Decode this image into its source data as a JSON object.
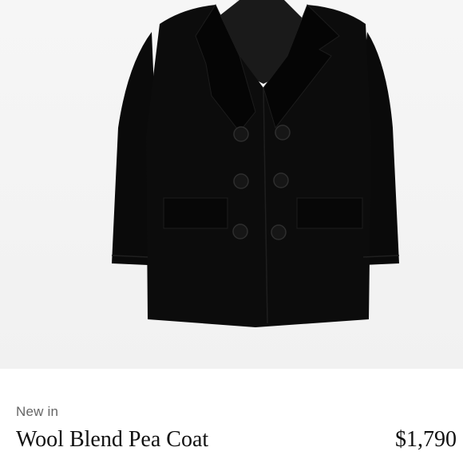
{
  "product": {
    "badge": "New in",
    "name": "Wool Blend Pea Coat",
    "price": "$1,790"
  },
  "colors": {
    "background": "#ffffff",
    "image_background": "#f3f3f3",
    "coat": "#0b0b0b",
    "badge_text": "#666666",
    "title_text": "#111111"
  },
  "image": {
    "subject": "black double-breasted pea coat",
    "button_count": 6
  }
}
